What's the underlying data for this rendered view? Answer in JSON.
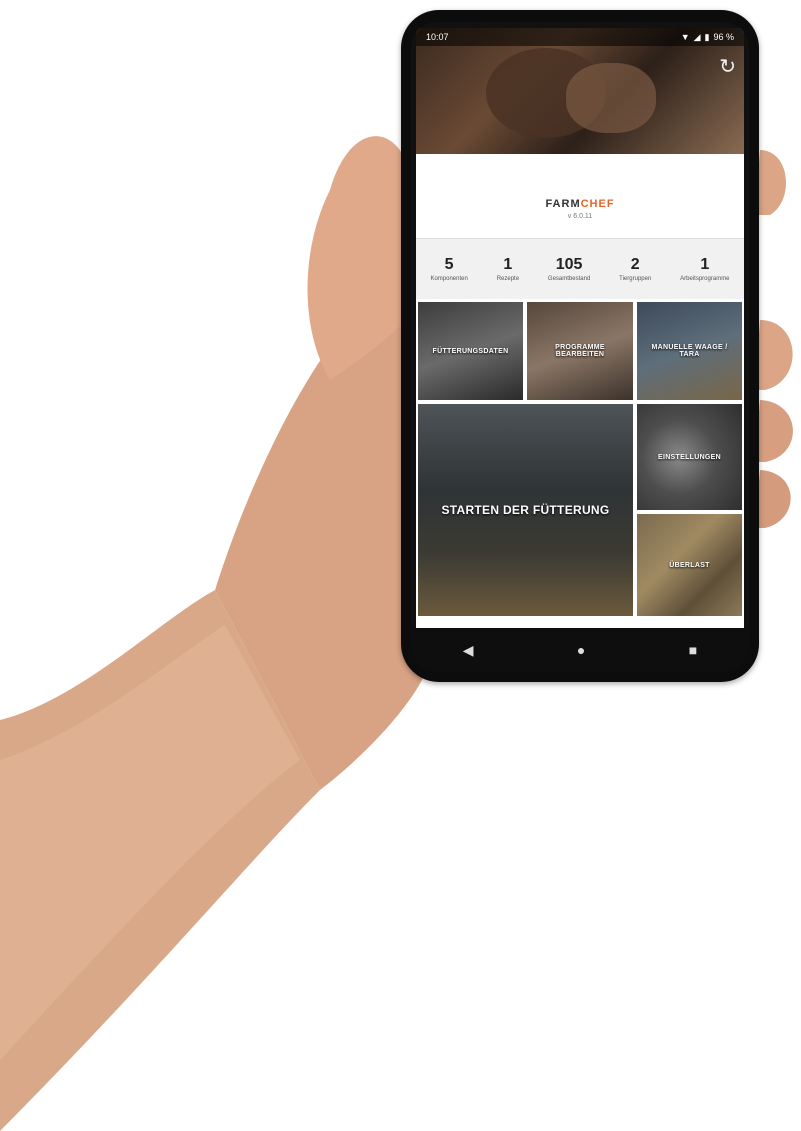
{
  "status_bar": {
    "time": "10:07",
    "battery": "96 %"
  },
  "brand": {
    "logo_part1": "FARM",
    "logo_part2": "CHEF",
    "version": "v 6.0.11"
  },
  "stats": [
    {
      "value": "5",
      "label": "Komponenten"
    },
    {
      "value": "1",
      "label": "Rezepte"
    },
    {
      "value": "105",
      "label": "Gesamtbestand"
    },
    {
      "value": "2",
      "label": "Tiergruppen"
    },
    {
      "value": "1",
      "label": "Arbeitsprogramme"
    }
  ],
  "tiles": {
    "feeding_data": "FÜTTERUNGSDATEN",
    "edit_programs": "PROGRAMME BEARBEITEN",
    "manual_scale": "MANUELLE WAAGE / TARA",
    "start_feeding": "STARTEN DER FÜTTERUNG",
    "settings": "EINSTELLUNGEN",
    "overload": "ÜBERLAST"
  },
  "nav": {
    "back": "◀",
    "home": "●",
    "recents": "■"
  }
}
